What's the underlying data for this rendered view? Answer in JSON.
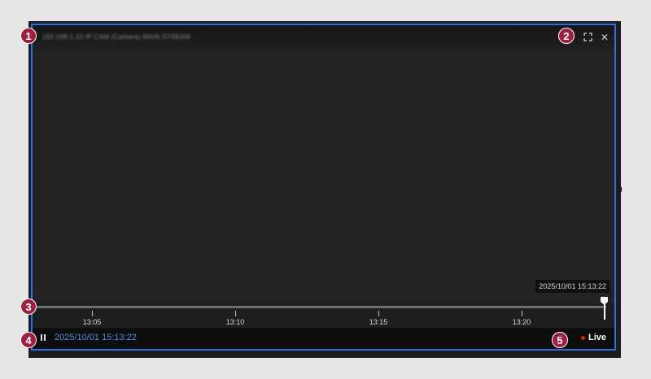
{
  "player": {
    "camera_title": "192.168.1.10 IP CAM (Camera) MAIN STREAM",
    "icons": {
      "fullscreen": "fullscreen-icon",
      "close": "close-icon"
    },
    "close_glyph": "✕",
    "hover_timestamp": "2025/10/01 15:13:22"
  },
  "timeline": {
    "ticks": [
      "13:05",
      "13:10",
      "13:15",
      "13:20"
    ],
    "playhead_position": 0.99
  },
  "controls": {
    "pause_icon": "pause-icon",
    "current_time": "2025/10/01 15:13:22",
    "live_label": "Live",
    "live_color": "#e0201a",
    "time_color": "#4f8fdc"
  },
  "markers": [
    "1",
    "2",
    "3",
    "4",
    "5"
  ],
  "accent_border_color": "#2f6fe0"
}
